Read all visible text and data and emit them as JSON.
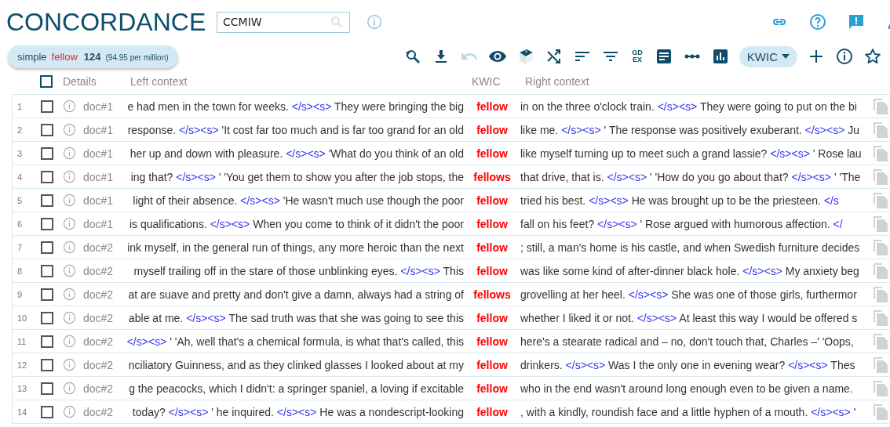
{
  "title": "CONCORDANCE",
  "search": {
    "value": "CCMIW"
  },
  "header_icons": [
    {
      "kind": "link"
    },
    {
      "kind": "help"
    },
    {
      "kind": "feedback"
    },
    {
      "kind": "user"
    }
  ],
  "query_chip": {
    "type": "simple",
    "term": "fellow",
    "count": "124",
    "relative": "(94.95 per million)"
  },
  "toolbar": [
    {
      "kind": "icon",
      "disabled": false
    },
    {
      "kind": "icon",
      "disabled": false
    },
    {
      "kind": "icon",
      "disabled": true
    },
    {
      "kind": "icon",
      "disabled": false
    },
    {
      "kind": "icon",
      "disabled": false
    },
    {
      "kind": "icon",
      "disabled": false
    },
    {
      "kind": "icon",
      "disabled": false
    },
    {
      "kind": "icon",
      "disabled": false
    },
    {
      "kind": "text",
      "lines": [
        "GD",
        "EX"
      ]
    },
    {
      "kind": "icon",
      "disabled": false
    },
    {
      "kind": "icon",
      "disabled": false
    },
    {
      "kind": "icon",
      "disabled": false
    },
    {
      "kind": "dropdown",
      "label": "KWIC"
    },
    {
      "kind": "icon",
      "disabled": false
    },
    {
      "kind": "icon",
      "disabled": false
    },
    {
      "kind": "icon",
      "disabled": false
    }
  ],
  "table": {
    "select_all_checked": false,
    "columns": [
      "Details",
      "Left context",
      "KWIC",
      "Right context"
    ],
    "rows": [
      {
        "number": "1",
        "checked": false,
        "doc": "doc#1",
        "left": [
          {
            "kind": "text",
            "text": "e had men in the town for weeks. "
          },
          {
            "kind": "tag",
            "text": "</s><s>"
          },
          {
            "kind": "text",
            "text": " They were bringing the big"
          }
        ],
        "kwic": "fellow",
        "right": [
          {
            "kind": "text",
            "text": "in on the three o'clock train. "
          },
          {
            "kind": "tag",
            "text": "</s><s>"
          },
          {
            "kind": "text",
            "text": " They were going to put on the bi"
          }
        ]
      },
      {
        "number": "2",
        "checked": false,
        "doc": "doc#1",
        "left": [
          {
            "kind": "text",
            "text": "response. "
          },
          {
            "kind": "tag",
            "text": "</s><s>"
          },
          {
            "kind": "text",
            "text": " 'It cost far too much and is far too grand for an old"
          }
        ],
        "kwic": "fellow",
        "right": [
          {
            "kind": "text",
            "text": "like me. "
          },
          {
            "kind": "tag",
            "text": "</s><s>"
          },
          {
            "kind": "text",
            "text": " ' The response was positively exuberant. "
          },
          {
            "kind": "tag",
            "text": "</s><s>"
          },
          {
            "kind": "text",
            "text": " Ju"
          }
        ]
      },
      {
        "number": "3",
        "checked": false,
        "doc": "doc#1",
        "left": [
          {
            "kind": "text",
            "text": "her up and down with pleasure. "
          },
          {
            "kind": "tag",
            "text": "</s><s>"
          },
          {
            "kind": "text",
            "text": " 'What do you think of an old"
          }
        ],
        "kwic": "fellow",
        "right": [
          {
            "kind": "text",
            "text": "like myself turning up to meet such a grand lassie? "
          },
          {
            "kind": "tag",
            "text": "</s><s>"
          },
          {
            "kind": "text",
            "text": " ' Rose lau"
          }
        ]
      },
      {
        "number": "4",
        "checked": false,
        "doc": "doc#1",
        "left": [
          {
            "kind": "text",
            "text": "ing that? "
          },
          {
            "kind": "tag",
            "text": "</s><s>"
          },
          {
            "kind": "text",
            "text": " ' 'You get them to show you after the job stops, the"
          }
        ],
        "kwic": "fellows",
        "right": [
          {
            "kind": "text",
            "text": "that drive, that is. "
          },
          {
            "kind": "tag",
            "text": "</s><s>"
          },
          {
            "kind": "text",
            "text": " ' 'How do you go about that? "
          },
          {
            "kind": "tag",
            "text": "</s><s>"
          },
          {
            "kind": "text",
            "text": " ' 'The"
          }
        ]
      },
      {
        "number": "5",
        "checked": false,
        "doc": "doc#1",
        "left": [
          {
            "kind": "text",
            "text": "light of their absence. "
          },
          {
            "kind": "tag",
            "text": "</s><s>"
          },
          {
            "kind": "text",
            "text": " 'He wasn't much use though the poor"
          }
        ],
        "kwic": "fellow",
        "right": [
          {
            "kind": "text",
            "text": "tried his best. "
          },
          {
            "kind": "tag",
            "text": "</s><s>"
          },
          {
            "kind": "text",
            "text": " He was brought up to be the priesteen. "
          },
          {
            "kind": "tag",
            "text": "</s"
          }
        ]
      },
      {
        "number": "6",
        "checked": false,
        "doc": "doc#1",
        "left": [
          {
            "kind": "text",
            "text": "is qualifications. "
          },
          {
            "kind": "tag",
            "text": "</s><s>"
          },
          {
            "kind": "text",
            "text": " When you come to think of it didn't the poor"
          }
        ],
        "kwic": "fellow",
        "right": [
          {
            "kind": "text",
            "text": "fall on his feet? "
          },
          {
            "kind": "tag",
            "text": "</s><s>"
          },
          {
            "kind": "text",
            "text": " ' Rose argued with humorous affection. "
          },
          {
            "kind": "tag",
            "text": "</"
          }
        ]
      },
      {
        "number": "7",
        "checked": false,
        "doc": "doc#2",
        "left": [
          {
            "kind": "text",
            "text": "ink myself, in the general run of things, any more heroic than the next"
          }
        ],
        "kwic": "fellow",
        "right": [
          {
            "kind": "text",
            "text": "; still, a man's home is his castle, and when Swedish furniture decides"
          }
        ]
      },
      {
        "number": "8",
        "checked": false,
        "doc": "doc#2",
        "left": [
          {
            "kind": "text",
            "text": "myself trailing off in the stare of those unblinking eyes. "
          },
          {
            "kind": "tag",
            "text": "</s><s>"
          },
          {
            "kind": "text",
            "text": " This"
          }
        ],
        "kwic": "fellow",
        "right": [
          {
            "kind": "text",
            "text": "was like some kind of after-dinner black hole. "
          },
          {
            "kind": "tag",
            "text": "</s><s>"
          },
          {
            "kind": "text",
            "text": " My anxiety beg"
          }
        ]
      },
      {
        "number": "9",
        "checked": false,
        "doc": "doc#2",
        "left": [
          {
            "kind": "text",
            "text": "at are suave and pretty and don't give a damn, always had a string of"
          }
        ],
        "kwic": "fellows",
        "right": [
          {
            "kind": "text",
            "text": "grovelling at her heel. "
          },
          {
            "kind": "tag",
            "text": "</s><s>"
          },
          {
            "kind": "text",
            "text": " She was one of those girls, furthermor"
          }
        ]
      },
      {
        "number": "10",
        "checked": false,
        "doc": "doc#2",
        "left": [
          {
            "kind": "text",
            "text": "able at me. "
          },
          {
            "kind": "tag",
            "text": "</s><s>"
          },
          {
            "kind": "text",
            "text": " The sad truth was that she was going to see this"
          }
        ],
        "kwic": "fellow",
        "right": [
          {
            "kind": "text",
            "text": "whether I liked it or not. "
          },
          {
            "kind": "tag",
            "text": "</s><s>"
          },
          {
            "kind": "text",
            "text": " At least this way I would be offered s"
          }
        ]
      },
      {
        "number": "11",
        "checked": false,
        "doc": "doc#2",
        "left": [
          {
            "kind": "tag",
            "text": "</s><s>"
          },
          {
            "kind": "text",
            "text": " ' 'Ah, well that's a chemical formula, is what that's called, this"
          }
        ],
        "kwic": "fellow",
        "right": [
          {
            "kind": "text",
            "text": "here's a stearate radical and – no, don't touch that, Charles –' 'Oops,"
          }
        ]
      },
      {
        "number": "12",
        "checked": false,
        "doc": "doc#2",
        "left": [
          {
            "kind": "text",
            "text": "nciliatory Guinness, and as they clinked glasses I looked about at my"
          }
        ],
        "kwic": "fellow",
        "right": [
          {
            "kind": "text",
            "text": "drinkers. "
          },
          {
            "kind": "tag",
            "text": "</s><s>"
          },
          {
            "kind": "text",
            "text": " Was I the only one in evening wear? "
          },
          {
            "kind": "tag",
            "text": "</s><s>"
          },
          {
            "kind": "text",
            "text": " Thes"
          }
        ]
      },
      {
        "number": "13",
        "checked": false,
        "doc": "doc#2",
        "left": [
          {
            "kind": "text",
            "text": "g the peacocks, which I didn't: a springer spaniel, a loving if excitable"
          }
        ],
        "kwic": "fellow",
        "right": [
          {
            "kind": "text",
            "text": "who in the end wasn't around long enough even to be given a name."
          }
        ]
      },
      {
        "number": "14",
        "checked": false,
        "doc": "doc#2",
        "left": [
          {
            "kind": "text",
            "text": "today? "
          },
          {
            "kind": "tag",
            "text": "</s><s>"
          },
          {
            "kind": "text",
            "text": " ' he inquired. "
          },
          {
            "kind": "tag",
            "text": "</s><s>"
          },
          {
            "kind": "text",
            "text": " He was a nondescript-looking"
          }
        ],
        "kwic": "fellow",
        "right": [
          {
            "kind": "text",
            "text": ", with a kindly, roundish face and a little hyphen of a mouth. "
          },
          {
            "kind": "tag",
            "text": "</s><s>"
          },
          {
            "kind": "text",
            "text": " '"
          }
        ]
      }
    ]
  }
}
